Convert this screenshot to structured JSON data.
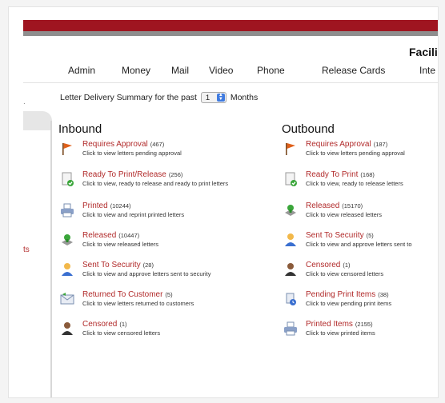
{
  "header": {
    "brand": "Facili"
  },
  "nav": {
    "items": [
      {
        "label": "Admin",
        "key": "admin"
      },
      {
        "label": "Money",
        "key": "money"
      },
      {
        "label": "Mail",
        "key": "mail"
      },
      {
        "label": "Video",
        "key": "video"
      },
      {
        "label": "Phone",
        "key": "phone"
      },
      {
        "label": "Release Cards",
        "key": "release-cards"
      },
      {
        "label": "Inte",
        "key": "inte"
      }
    ]
  },
  "sidebar": {
    "dot": ".",
    "tab_text": "ts"
  },
  "summary": {
    "prefix": "Letter Delivery Summary for the past",
    "months_value": "1",
    "suffix": "Months"
  },
  "colors": {
    "link": "#b12a2a",
    "redbar": "#9f1520",
    "graybar": "#8e8e8e"
  },
  "inbound": {
    "title": "Inbound",
    "items": [
      {
        "title": "Requires Approval",
        "count": "(467)",
        "desc": "Click to view letters pending approval",
        "icon": "flag-icon"
      },
      {
        "title": "Ready To Print/Release",
        "count": "(256)",
        "desc": "Click to view, ready to release and ready to print letters",
        "icon": "document-check-icon"
      },
      {
        "title": "Printed",
        "count": "(10244)",
        "desc": "Click to view and reprint printed letters",
        "icon": "printer-icon"
      },
      {
        "title": "Released",
        "count": "(10447)",
        "desc": "Click to view released letters",
        "icon": "stamp-icon"
      },
      {
        "title": "Sent To Security",
        "count": "(28)",
        "desc": "Click to view and approve letters sent to security",
        "icon": "security-user-icon"
      },
      {
        "title": "Returned To Customer",
        "count": "(5)",
        "desc": "Click to view letters returned to customers",
        "icon": "returned-envelope-icon"
      },
      {
        "title": "Censored",
        "count": "(1)",
        "desc": "Click to view censored letters",
        "icon": "censored-user-icon"
      }
    ]
  },
  "outbound": {
    "title": "Outbound",
    "items": [
      {
        "title": "Requires Approval",
        "count": "(187)",
        "desc": "Click to view letters pending approval",
        "icon": "flag-icon"
      },
      {
        "title": "Ready To Print",
        "count": "(168)",
        "desc": "Click to view, ready to release letters",
        "icon": "document-check-icon"
      },
      {
        "title": "Released",
        "count": "(15170)",
        "desc": "Click to view released letters",
        "icon": "stamp-icon"
      },
      {
        "title": "Sent To Security",
        "count": "(5)",
        "desc": "Click to view and approve letters sent to",
        "icon": "security-user-icon"
      },
      {
        "title": "Censored",
        "count": "(1)",
        "desc": "Click to view censored letters",
        "icon": "censored-user-icon"
      },
      {
        "title": "Pending Print Items",
        "count": "(38)",
        "desc": "Click to view pending print items",
        "icon": "pending-print-icon"
      },
      {
        "title": "Printed Items",
        "count": "(2155)",
        "desc": "Click to view printed items",
        "icon": "printer-icon"
      }
    ]
  }
}
